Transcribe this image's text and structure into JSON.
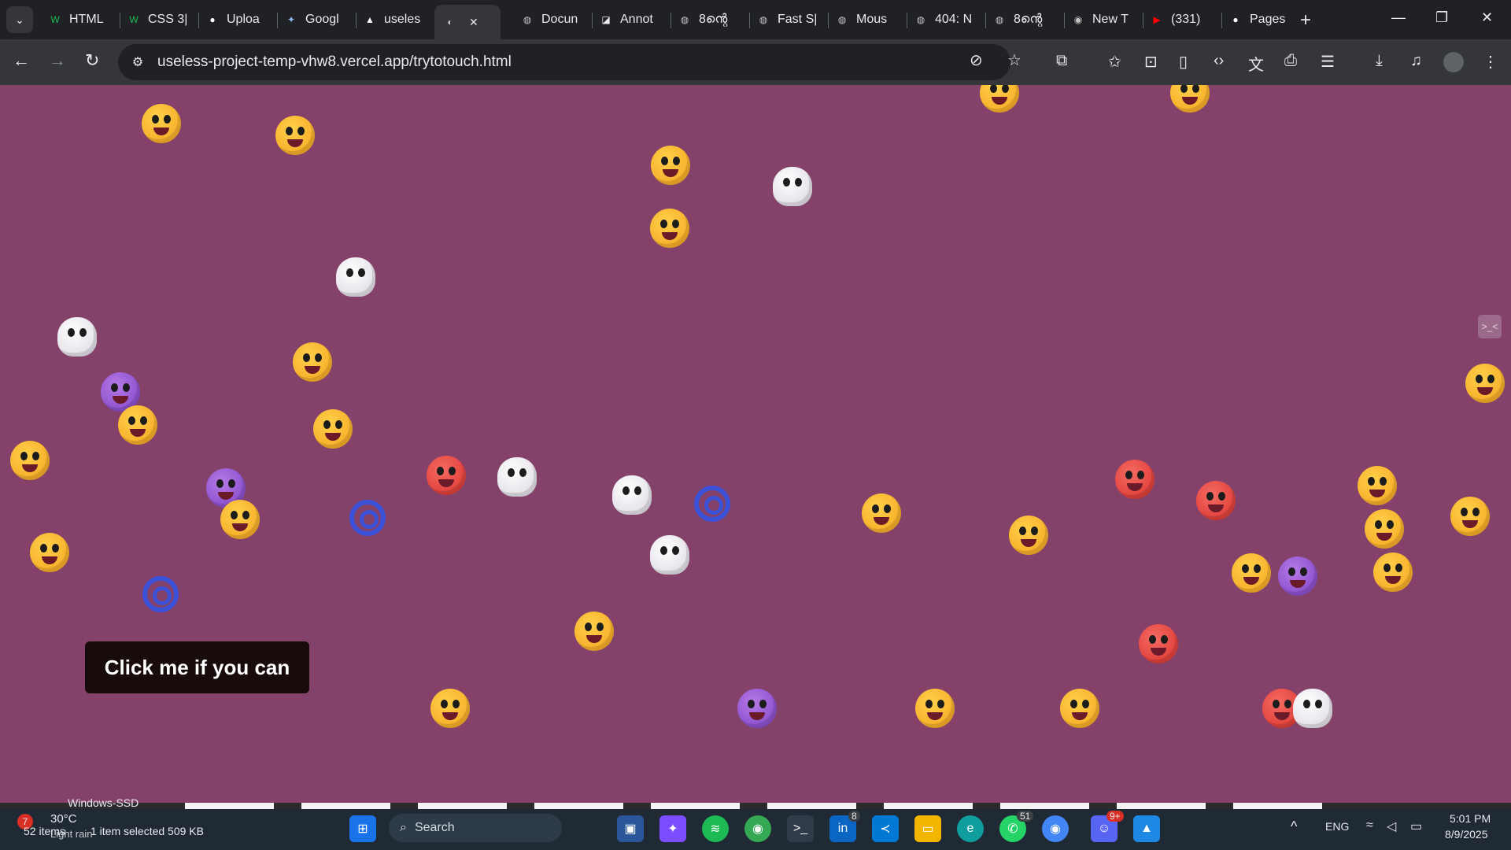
{
  "browser": {
    "tabs": [
      {
        "label": "HTML",
        "icon": "w3-icon",
        "icon_color": "#1db954"
      },
      {
        "label": "CSS 3|",
        "icon": "w3-icon",
        "icon_color": "#1db954"
      },
      {
        "label": "Uploa",
        "icon": "github-icon",
        "icon_color": "#ffffff"
      },
      {
        "label": "Googl",
        "icon": "gemini-icon",
        "icon_color": "#8ab4f8"
      },
      {
        "label": "useles",
        "icon": "vercel-icon",
        "icon_color": "#ffffff"
      },
      {
        "label": "",
        "icon": "page-icon",
        "icon_color": "#c4c7c5",
        "active": true
      },
      {
        "label": "Docun",
        "icon": "globe-icon",
        "icon_color": "#c4c7c5"
      },
      {
        "label": "Annot",
        "icon": "annot-icon",
        "icon_color": "#e8eaed"
      },
      {
        "label": "8ന്റെ",
        "icon": "globe-icon",
        "icon_color": "#c4c7c5"
      },
      {
        "label": "Fast S|",
        "icon": "globe-icon",
        "icon_color": "#c4c7c5"
      },
      {
        "label": "Mous",
        "icon": "globe-icon",
        "icon_color": "#c4c7c5"
      },
      {
        "label": "404: N",
        "icon": "globe-icon",
        "icon_color": "#c4c7c5"
      },
      {
        "label": "8ന്റെ",
        "icon": "globe-icon",
        "icon_color": "#c4c7c5"
      },
      {
        "label": "New T",
        "icon": "chrome-icon",
        "icon_color": "#c4c7c5"
      },
      {
        "label": "(331)",
        "icon": "youtube-icon",
        "icon_color": "#ff0000"
      },
      {
        "label": "Pages",
        "icon": "github-icon",
        "icon_color": "#ffffff"
      }
    ],
    "url": "useless-project-temp-vhw8.vercel.app/trytotouch.html"
  },
  "page": {
    "button_label": "Click me if you can",
    "background": "#84426b",
    "side_tab_label": ">_<",
    "emojis": [
      {
        "type": "yellow"
      },
      {
        "type": "yellow"
      },
      {
        "type": "yellow"
      },
      {
        "type": "yellow"
      },
      {
        "type": "yellow"
      },
      {
        "type": "yellow"
      },
      {
        "type": "skull"
      },
      {
        "type": "yellow"
      },
      {
        "type": "skull"
      },
      {
        "type": "skull"
      },
      {
        "type": "yellow"
      },
      {
        "type": "purple"
      },
      {
        "type": "yellow"
      },
      {
        "type": "yellow"
      },
      {
        "type": "yellow"
      },
      {
        "type": "purple"
      },
      {
        "type": "yellow"
      },
      {
        "type": "swirl"
      },
      {
        "type": "red"
      },
      {
        "type": "skull"
      },
      {
        "type": "skull"
      },
      {
        "type": "swirl"
      },
      {
        "type": "skull"
      },
      {
        "type": "yellow"
      },
      {
        "type": "yellow"
      },
      {
        "type": "swirl"
      },
      {
        "type": "yellow"
      },
      {
        "type": "yellow"
      },
      {
        "type": "yellow"
      },
      {
        "type": "red"
      },
      {
        "type": "yellow"
      },
      {
        "type": "yellow"
      },
      {
        "type": "yellow"
      },
      {
        "type": "purple"
      },
      {
        "type": "yellow"
      },
      {
        "type": "red"
      },
      {
        "type": "yellow"
      },
      {
        "type": "red"
      },
      {
        "type": "yellow"
      },
      {
        "type": "purple"
      },
      {
        "type": "yellow"
      },
      {
        "type": "yellow"
      },
      {
        "type": "red"
      },
      {
        "type": "yellow"
      },
      {
        "type": "skull"
      },
      {
        "type": "yellow"
      }
    ]
  },
  "status_bar": {
    "explorer_label": "Windows-SSD",
    "items_text": "52 items",
    "selected_text": "1 item selected  509 KB"
  },
  "taskbar": {
    "weather_temp": "30°C",
    "weather_desc": "Light rain",
    "weather_badge": "7",
    "search_label": "Search",
    "language": "ENG",
    "time": "5:01 PM",
    "date": "8/9/2025",
    "linkedin_badge": "8",
    "whatsapp_badge": "51",
    "discord_badge": "9+"
  }
}
